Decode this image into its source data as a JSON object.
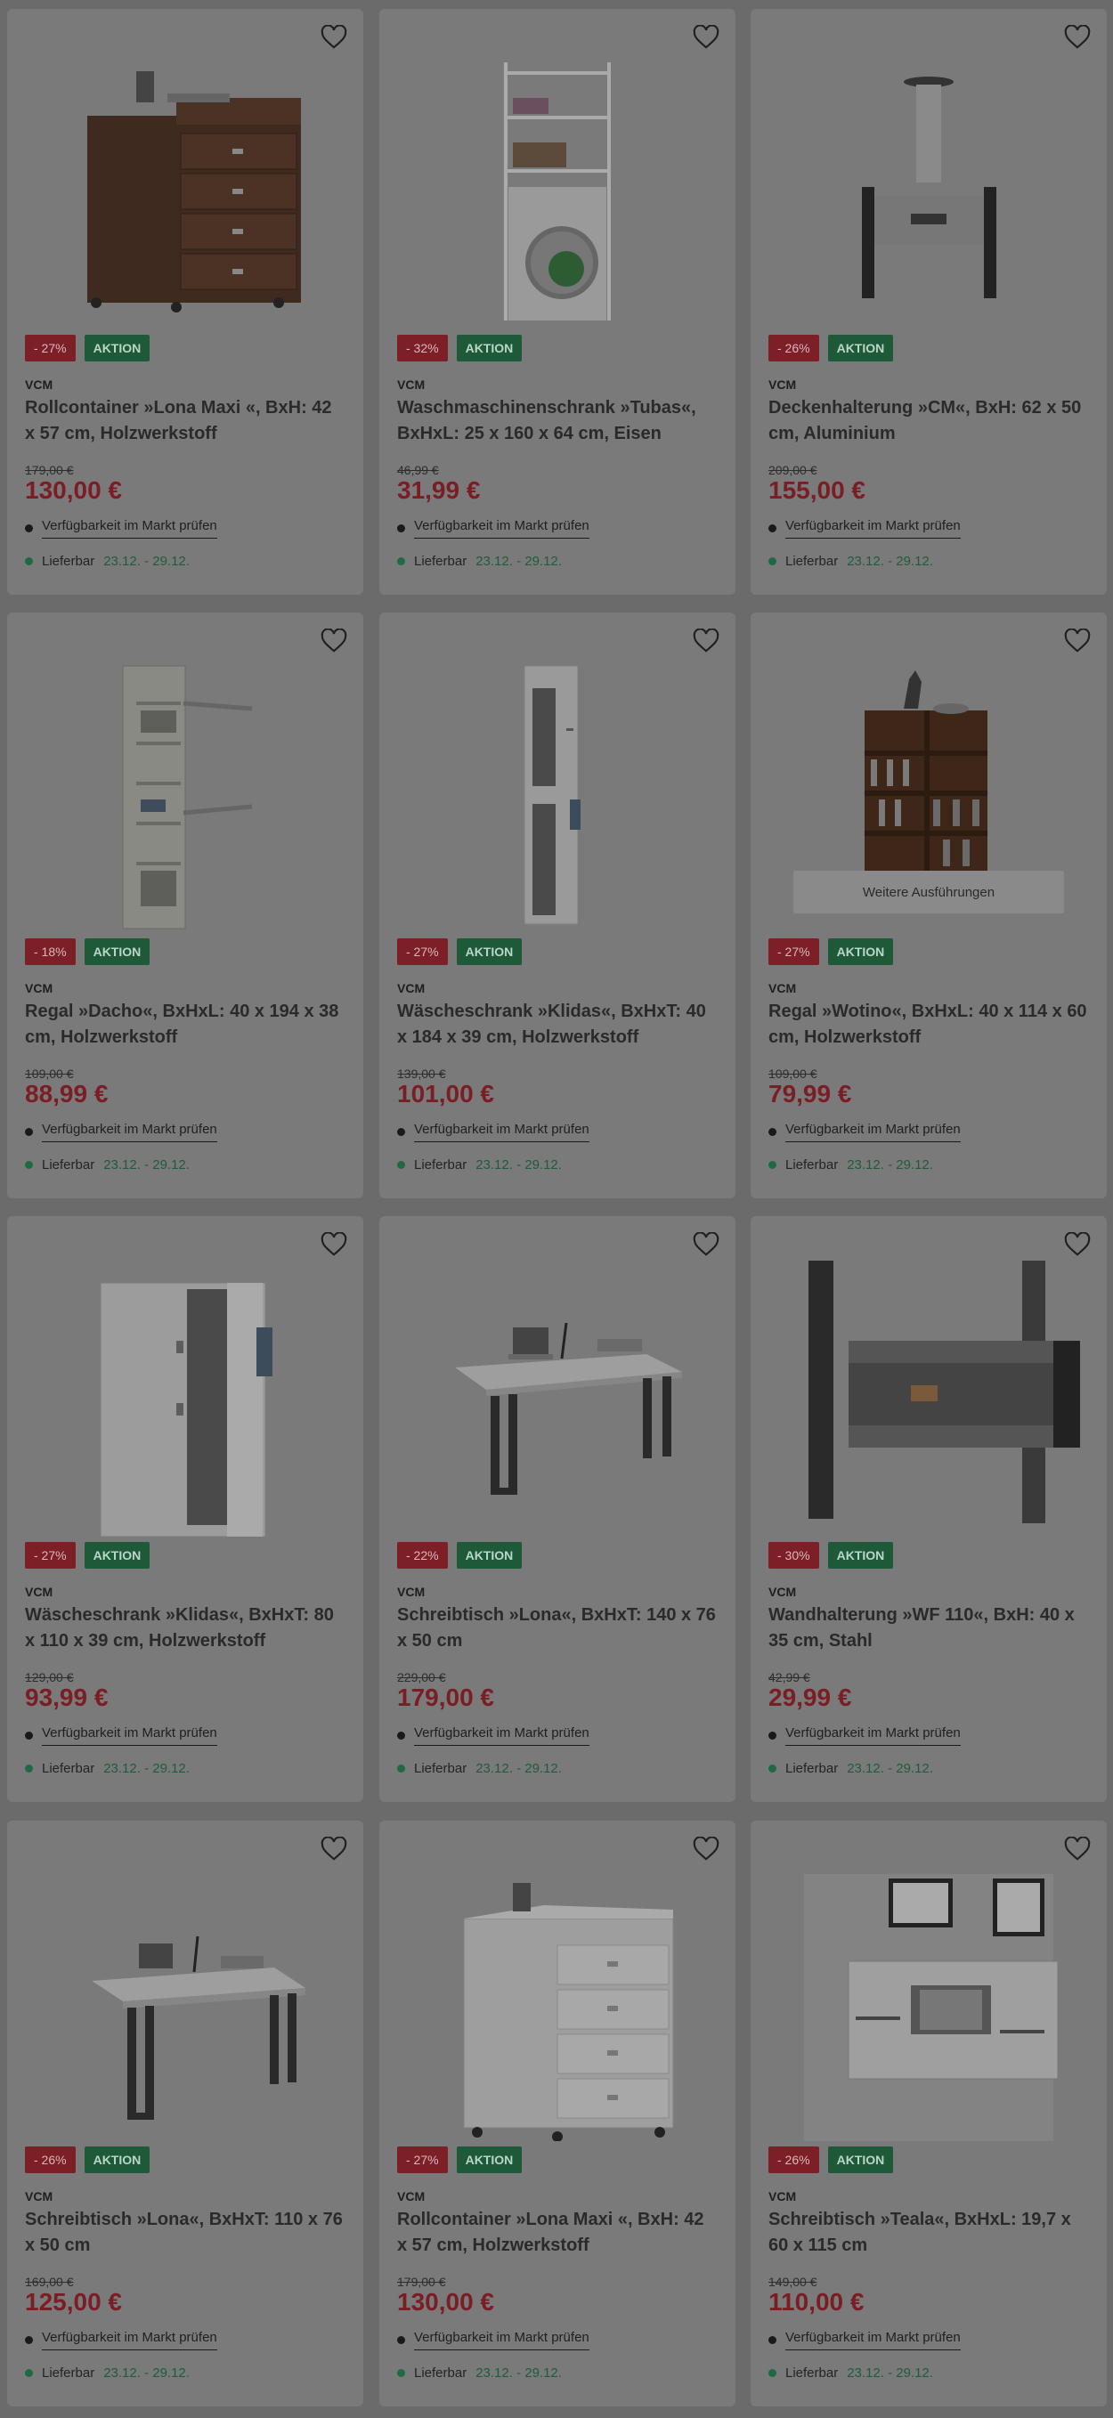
{
  "products": [
    {
      "discount": "- 27%",
      "tag": "AKTION",
      "brand": "VCM",
      "title": "Rollcontainer »Lona Maxi «, BxH: 42 x 57 cm, Holzwerkstoff",
      "old_price": "179,00 €",
      "price": "130,00 €",
      "availability": "Verfügbarkeit im Markt prüfen",
      "delivery_label": "Lieferbar",
      "delivery_dates": "23.12. - 29.12.",
      "image": "walnut-rollcontainer",
      "more_label": ""
    },
    {
      "discount": "- 32%",
      "tag": "AKTION",
      "brand": "VCM",
      "title": "Waschmaschinenschrank »Tubas«, BxHxL: 25 x 160 x 64 cm, Eisen",
      "old_price": "46,99 €",
      "price": "31,99 €",
      "availability": "Verfügbarkeit im Markt prüfen",
      "delivery_label": "Lieferbar",
      "delivery_dates": "23.12. - 29.12.",
      "image": "washing-machine-shelf",
      "more_label": ""
    },
    {
      "discount": "- 26%",
      "tag": "AKTION",
      "brand": "VCM",
      "title": "Deckenhalterung »CM«, BxH: 62 x 50 cm, Aluminium",
      "old_price": "209,00 €",
      "price": "155,00 €",
      "availability": "Verfügbarkeit im Markt prüfen",
      "delivery_label": "Lieferbar",
      "delivery_dates": "23.12. - 29.12.",
      "image": "ceiling-mount",
      "more_label": ""
    },
    {
      "discount": "- 18%",
      "tag": "AKTION",
      "brand": "VCM",
      "title": "Regal »Dacho«, BxHxL: 40 x 194 x 38 cm, Holzwerkstoff",
      "old_price": "109,00 €",
      "price": "88,99 €",
      "availability": "Verfügbarkeit im Markt prüfen",
      "delivery_label": "Lieferbar",
      "delivery_dates": "23.12. - 29.12.",
      "image": "shelf-dacho",
      "more_label": ""
    },
    {
      "discount": "- 27%",
      "tag": "AKTION",
      "brand": "VCM",
      "title": "Wäscheschrank »Klidas«, BxHxT: 40 x 184 x 39 cm, Holzwerkstoff",
      "old_price": "139,00 €",
      "price": "101,00 €",
      "availability": "Verfügbarkeit im Markt prüfen",
      "delivery_label": "Lieferbar",
      "delivery_dates": "23.12. - 29.12.",
      "image": "laundry-cabinet-narrow",
      "more_label": ""
    },
    {
      "discount": "- 27%",
      "tag": "AKTION",
      "brand": "VCM",
      "title": "Regal »Wotino«, BxHxL: 40 x 114 x 60 cm, Holzwerkstoff",
      "old_price": "109,00 €",
      "price": "79,99 €",
      "availability": "Verfügbarkeit im Markt prüfen",
      "delivery_label": "Lieferbar",
      "delivery_dates": "23.12. - 29.12.",
      "image": "bookshelf-wotino",
      "more_label": "Weitere Ausführungen"
    },
    {
      "discount": "- 27%",
      "tag": "AKTION",
      "brand": "VCM",
      "title": "Wäscheschrank »Klidas«, BxHxT: 80 x 110 x 39 cm, Holzwerkstoff",
      "old_price": "129,00 €",
      "price": "93,99 €",
      "availability": "Verfügbarkeit im Markt prüfen",
      "delivery_label": "Lieferbar",
      "delivery_dates": "23.12. - 29.12.",
      "image": "laundry-cabinet-wide",
      "more_label": ""
    },
    {
      "discount": "- 22%",
      "tag": "AKTION",
      "brand": "VCM",
      "title": "Schreibtisch »Lona«, BxHxT: 140 x 76 x 50 cm",
      "old_price": "229,00 €",
      "price": "179,00 €",
      "availability": "Verfügbarkeit im Markt prüfen",
      "delivery_label": "Lieferbar",
      "delivery_dates": "23.12. - 29.12.",
      "image": "desk-lona-140",
      "more_label": ""
    },
    {
      "discount": "- 30%",
      "tag": "AKTION",
      "brand": "VCM",
      "title": "Wandhalterung »WF 110«, BxH: 40 x 35 cm, Stahl",
      "old_price": "42,99 €",
      "price": "29,99 €",
      "availability": "Verfügbarkeit im Markt prüfen",
      "delivery_label": "Lieferbar",
      "delivery_dates": "23.12. - 29.12.",
      "image": "wall-mount",
      "more_label": ""
    },
    {
      "discount": "- 26%",
      "tag": "AKTION",
      "brand": "VCM",
      "title": "Schreibtisch »Lona«, BxHxT: 110 x 76 x 50 cm",
      "old_price": "169,00 €",
      "price": "125,00 €",
      "availability": "Verfügbarkeit im Markt prüfen",
      "delivery_label": "Lieferbar",
      "delivery_dates": "23.12. - 29.12.",
      "image": "desk-lona-110",
      "more_label": ""
    },
    {
      "discount": "- 27%",
      "tag": "AKTION",
      "brand": "VCM",
      "title": "Rollcontainer »Lona Maxi «, BxH: 42 x 57 cm, Holzwerkstoff",
      "old_price": "179,00 €",
      "price": "130,00 €",
      "availability": "Verfügbarkeit im Markt prüfen",
      "delivery_label": "Lieferbar",
      "delivery_dates": "23.12. - 29.12.",
      "image": "white-rollcontainer",
      "more_label": ""
    },
    {
      "discount": "- 26%",
      "tag": "AKTION",
      "brand": "VCM",
      "title": "Schreibtisch »Teala«, BxHxL: 19,7 x 60 x 115 cm",
      "old_price": "149,00 €",
      "price": "110,00 €",
      "availability": "Verfügbarkeit im Markt prüfen",
      "delivery_label": "Lieferbar",
      "delivery_dates": "23.12. - 29.12.",
      "image": "wall-desk-teala",
      "more_label": ""
    }
  ],
  "colors": {
    "discount": "#7c1f26",
    "action": "#1e5a3a",
    "price": "#7b1d24",
    "delivery": "#1f5c3b",
    "overlay": "#6b6b6b"
  },
  "icons": {
    "wishlist": "heart-icon",
    "availability": "dot-icon",
    "delivery": "green-dot-icon"
  }
}
